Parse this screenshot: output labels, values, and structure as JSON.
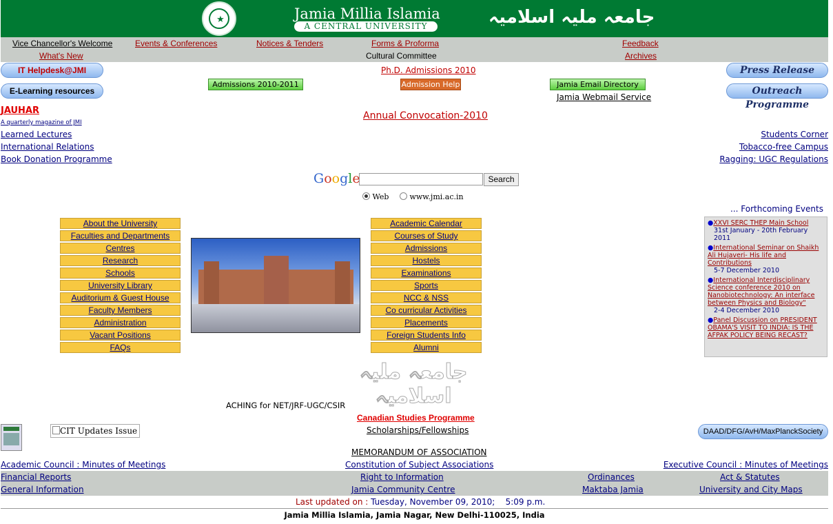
{
  "header": {
    "title_en": "Jamia Millia Islamia",
    "subtitle_en": "A CENTRAL UNIVERSITY",
    "title_ur": "جامعہ ملیہ اسلامیہ"
  },
  "nav": {
    "vc_welcome": "Vice Chancellor's Welcome",
    "events": "Events & Conferences",
    "notices": "Notices & Tenders",
    "forms": "Forms & Proforma",
    "feedback": "Feedback",
    "whats_new": "What's New",
    "cultural": "Cultural Committee",
    "archives": "Archives"
  },
  "buttons": {
    "it_helpdesk": "IT Helpdesk@JMI",
    "elearning": "E-Learning resources",
    "press_release": "Press Release",
    "outreach": "Outreach Programme",
    "phd_admissions": "Ph.D. Admissions 2010",
    "admissions_2010": "Admissions 2010-2011",
    "admission_help": "Admission Help",
    "email_directory": "Jamia Email Directory",
    "webmail": "Jamia Webmail Service",
    "daad": "DAAD/DFG/AvH/MaxPlanckSociety"
  },
  "left_links": {
    "jauhar": "JAUHAR",
    "jauhar_sub": "A quarterly magazine of JMI",
    "learned": "Learned Lectures",
    "intl": "International Relations",
    "book": "Book Donation Programme"
  },
  "right_links": {
    "students": "Students Corner",
    "tobacco": "Tobacco-free Campus",
    "ragging": "Ragging: UGC Regulations"
  },
  "convocation": "Annual Convocation-2010",
  "search": {
    "logo": "Google",
    "button": "Search",
    "value": "",
    "opt_web": "Web",
    "opt_site": "www.jmi.ac.in"
  },
  "menu_left": [
    "About the University",
    "Faculties and Departments",
    "Centres",
    "Research",
    "Schools",
    "University Library",
    "Auditorium & Guest House",
    "Faculty Members",
    "Administration",
    "Vacant Positions",
    "FAQs"
  ],
  "menu_right": [
    "Academic Calendar",
    "Courses of Study",
    "Admissions",
    "Hostels",
    "Examinations",
    "Sports",
    "NCC & NSS",
    "Co curricular Activities",
    "Placements",
    "Foreign Students Info",
    "Alumni"
  ],
  "events": {
    "heading": "... Forthcoming Events ...",
    "items": [
      {
        "title": "XXVI SERC THEP Main School",
        "date": "31st January - 20th February 2011"
      },
      {
        "title": "International Seminar on Shaikh Ali Hujaveri- His life and Contributions",
        "date": "5-7 December 2010"
      },
      {
        "title": "International Interdisciplinary Science conference 2010 on Nanobiotechnology: An interface between Physics and Biology\"",
        "date": "2-4 December 2010"
      },
      {
        "title": "Panel Discussion on PRESIDENT OBAMA'S VISIT TO INDIA: IS THE AFPAK POLICY BEING RECAST?",
        "date": ""
      }
    ]
  },
  "marquee": "ACHING for NET/JRF-UGC/CSIR",
  "canadian": "Canadian Studies Programme",
  "scholarships": "Scholarships/Fellowships",
  "cit_alt": "CIT Updates Issue",
  "memorandum": "MEMORANDUM OF ASSOCIATION",
  "footer": {
    "academic_council": "Academic Council : Minutes of Meetings",
    "constitution": "Constitution of Subject Associations",
    "executive_council": "Executive Council : Minutes of Meetings",
    "financial": "Financial Reports",
    "rti": "Right to Information",
    "ordinances": "Ordinances",
    "act": "Act & Statutes",
    "general": "General Information",
    "community": "Jamia Community Centre",
    "maktaba": "Maktaba Jamia",
    "maps": "University and City Maps",
    "updated_label": "Last updated on :",
    "updated_value": "Tuesday, November 09, 2010;    5:09 p.m.",
    "address": "Jamia Millia Islamia, Jamia Nagar, New Delhi-110025, India"
  }
}
